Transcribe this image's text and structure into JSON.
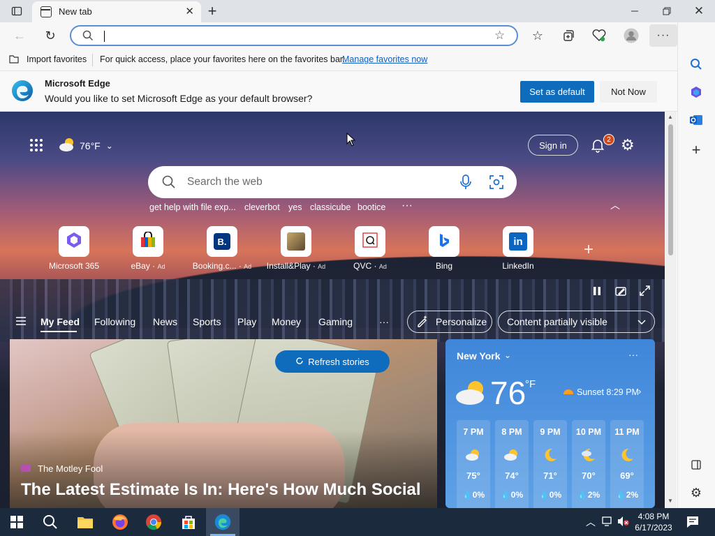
{
  "browser": {
    "tab_title": "New tab",
    "address_value": "",
    "favorites_bar": {
      "import_label": "Import favorites",
      "hint_text": "For quick access, place your favorites here on the favorites bar.",
      "manage_link": "Manage favorites now"
    },
    "infobar": {
      "title": "Microsoft Edge",
      "message": "Would you like to set Microsoft Edge as your default browser?",
      "primary_button": "Set as default",
      "secondary_button": "Not Now"
    }
  },
  "newtab": {
    "weather_temp_small": "76°F",
    "sign_in": "Sign in",
    "notification_count": "2",
    "search_placeholder": "Search the web",
    "suggestions": [
      "get help with file exp...",
      "cleverbot",
      "yes",
      "classicube",
      "bootice"
    ],
    "more_dots": "···",
    "quick_links": [
      {
        "label": "Microsoft 365",
        "ad": "",
        "glyph": "◆",
        "color": "#7b5cf0"
      },
      {
        "label": "eBay",
        "ad": "Ad",
        "glyph": "▦",
        "color": "#e53238"
      },
      {
        "label": "Booking.c...",
        "ad": "Ad",
        "glyph": "B.",
        "color": "#003580"
      },
      {
        "label": "Install&Play",
        "ad": "Ad",
        "glyph": "▣",
        "color": "#6b5a3a"
      },
      {
        "label": "QVC",
        "ad": "Ad",
        "glyph": "Q",
        "color": "#333333"
      },
      {
        "label": "Bing",
        "ad": "",
        "glyph": "b",
        "color": "#1a73e8"
      },
      {
        "label": "LinkedIn",
        "ad": "",
        "glyph": "in",
        "color": "#0a66c2"
      }
    ],
    "feed_tabs": [
      "My Feed",
      "Following",
      "News",
      "Sports",
      "Play",
      "Money",
      "Gaming"
    ],
    "feed_more": "···",
    "personalize_label": "Personalize",
    "content_visibility": "Content partially visible",
    "refresh_label": "Refresh stories",
    "article": {
      "source": "The Motley Fool",
      "headline": "The Latest Estimate Is In: Here's How Much Social"
    },
    "weather_card": {
      "location": "New York",
      "temperature": "76",
      "unit": "°F",
      "sunset": "Sunset 8:29 PM",
      "hours": [
        {
          "time": "7 PM",
          "temp": "75°",
          "precip": "0%",
          "icon": "partly-cloudy"
        },
        {
          "time": "8 PM",
          "temp": "74°",
          "precip": "0%",
          "icon": "partly-cloudy"
        },
        {
          "time": "9 PM",
          "temp": "71°",
          "precip": "0%",
          "icon": "moon"
        },
        {
          "time": "10 PM",
          "temp": "70°",
          "precip": "2%",
          "icon": "moon-cloud"
        },
        {
          "time": "11 PM",
          "temp": "69°",
          "precip": "2%",
          "icon": "moon"
        }
      ]
    }
  },
  "taskbar": {
    "time": "4:08 PM",
    "date": "6/17/2023"
  }
}
